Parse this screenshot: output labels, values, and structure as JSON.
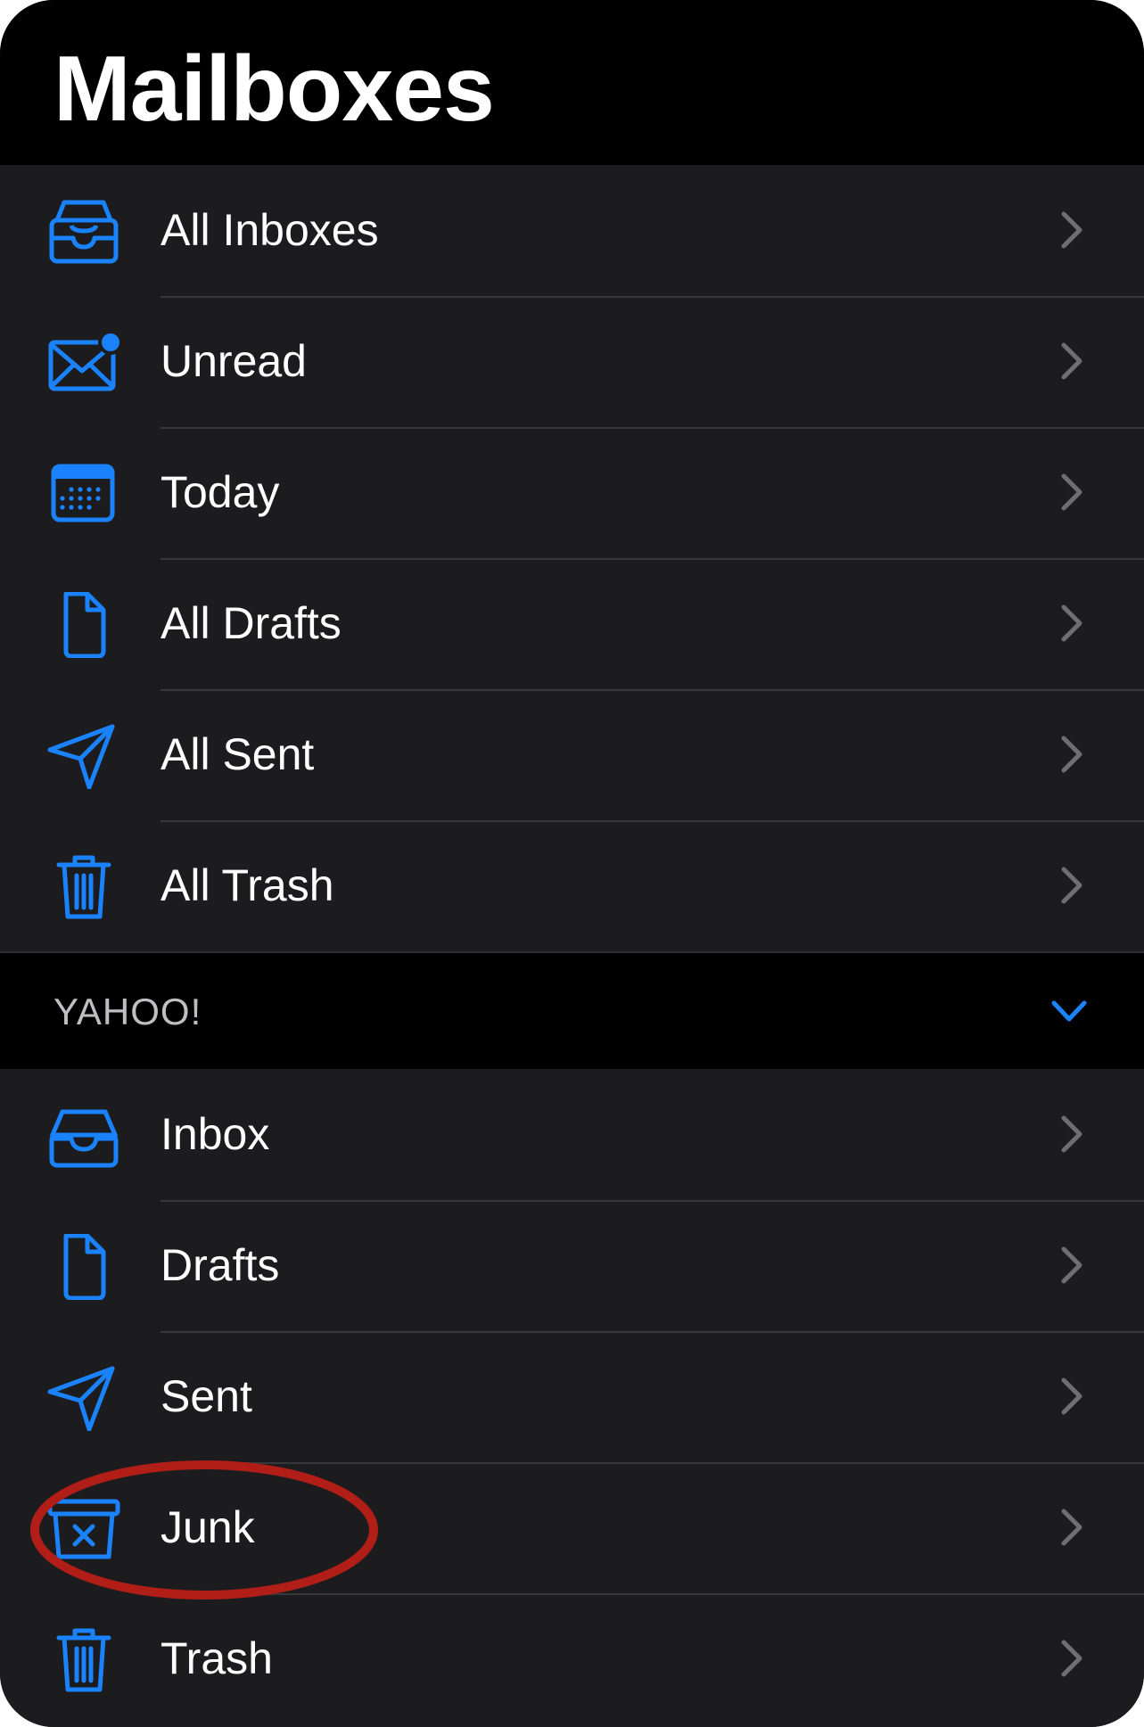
{
  "header": {
    "title": "Mailboxes"
  },
  "smart_mailboxes": [
    {
      "label": "All Inboxes",
      "icon": "tray-stack-icon"
    },
    {
      "label": "Unread",
      "icon": "envelope-badge-icon"
    },
    {
      "label": "Today",
      "icon": "calendar-icon"
    },
    {
      "label": "All Drafts",
      "icon": "document-icon"
    },
    {
      "label": "All Sent",
      "icon": "paperplane-icon"
    },
    {
      "label": "All Trash",
      "icon": "trash-icon"
    }
  ],
  "account": {
    "name": "YAHOO!",
    "mailboxes": [
      {
        "label": "Inbox",
        "icon": "tray-icon"
      },
      {
        "label": "Drafts",
        "icon": "document-icon"
      },
      {
        "label": "Sent",
        "icon": "paperplane-icon"
      },
      {
        "label": "Junk",
        "icon": "junk-icon"
      },
      {
        "label": "Trash",
        "icon": "trash-icon"
      }
    ]
  },
  "colors": {
    "accent": "#1a82fb",
    "background": "#000000",
    "row_background": "#1c1c1e",
    "separator": "#38383a",
    "chevron": "#6e6e73",
    "highlight": "#b01e17"
  },
  "annotation": {
    "highlighted_item": "Junk",
    "shape": "ellipse"
  }
}
